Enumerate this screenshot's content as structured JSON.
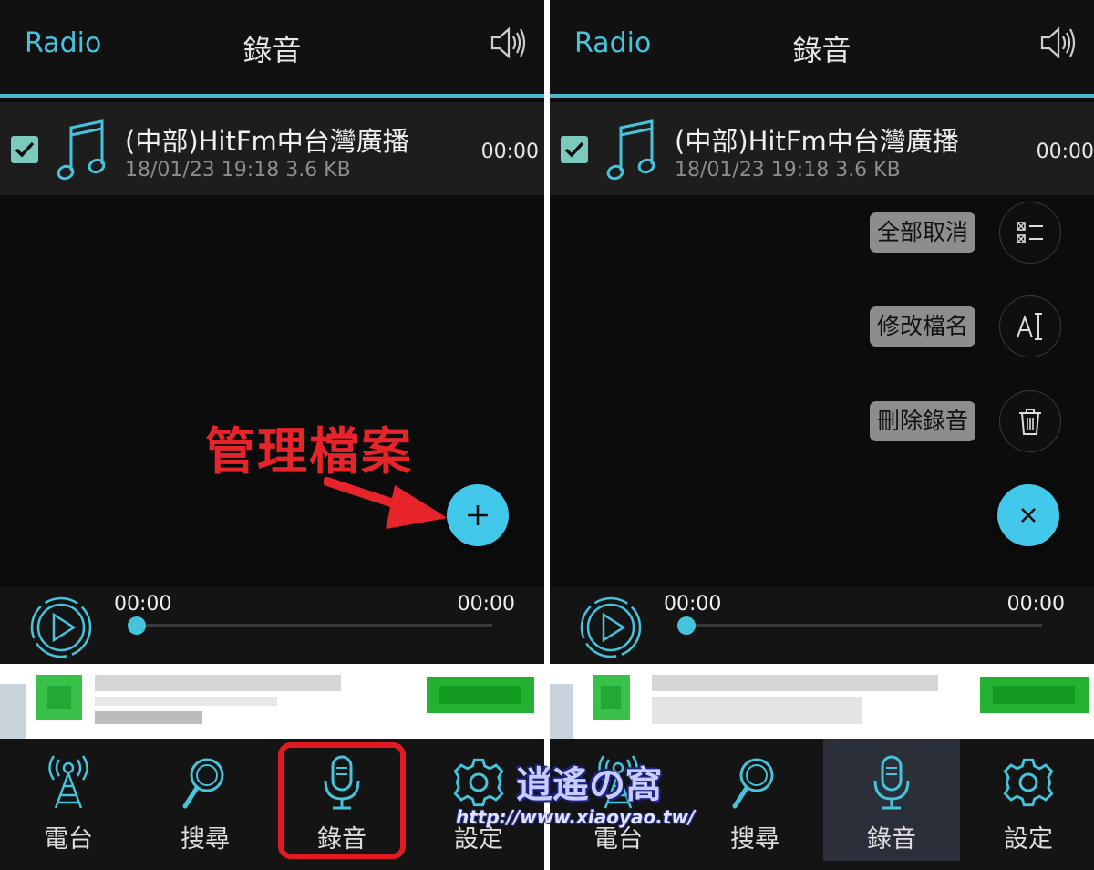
{
  "screens": [
    {
      "header": {
        "left_label": "Radio",
        "title": "錄音",
        "volume_icon": "speaker-icon"
      },
      "recording": {
        "name": "(中部)HitFm中台灣廣播",
        "meta": "18/01/23 19:18 3.6 KB",
        "duration": "00:00",
        "checked": true
      },
      "player": {
        "current": "00:00",
        "total": "00:00",
        "progress": 0
      },
      "tabs": [
        {
          "label": "電台",
          "icon": "antenna-icon",
          "active": false
        },
        {
          "label": "搜尋",
          "icon": "search-icon",
          "active": false
        },
        {
          "label": "錄音",
          "icon": "microphone-icon",
          "active": true
        },
        {
          "label": "設定",
          "icon": "gear-icon",
          "active": false
        }
      ],
      "fab_icon": "plus-icon"
    },
    {
      "header": {
        "left_label": "Radio",
        "title": "錄音",
        "volume_icon": "speaker-icon"
      },
      "recording": {
        "name": "(中部)HitFm中台灣廣播",
        "meta": "18/01/23 19:18 3.6 KB",
        "duration": "00:00",
        "checked": true
      },
      "player": {
        "current": "00:00",
        "total": "00:00",
        "progress": 0
      },
      "menu": [
        {
          "label": "全部取消",
          "icon": "deselect-all-icon"
        },
        {
          "label": "修改檔名",
          "icon": "rename-icon"
        },
        {
          "label": "刪除錄音",
          "icon": "trash-icon"
        }
      ],
      "tabs": [
        {
          "label": "電台",
          "icon": "antenna-icon",
          "active": false
        },
        {
          "label": "搜尋",
          "icon": "search-icon",
          "active": false
        },
        {
          "label": "錄音",
          "icon": "microphone-icon",
          "active": true
        },
        {
          "label": "設定",
          "icon": "gear-icon",
          "active": false
        }
      ],
      "fab_icon": "close-icon"
    }
  ],
  "annotation": {
    "text": "管理檔案",
    "color": "#e8242b"
  },
  "watermark": {
    "text": "逍遙の窩",
    "url": "http://www.xiaoyao.tw/"
  },
  "colors": {
    "accent": "#45c4dc",
    "fab": "#42c8ea",
    "highlight": "#e01b23"
  }
}
